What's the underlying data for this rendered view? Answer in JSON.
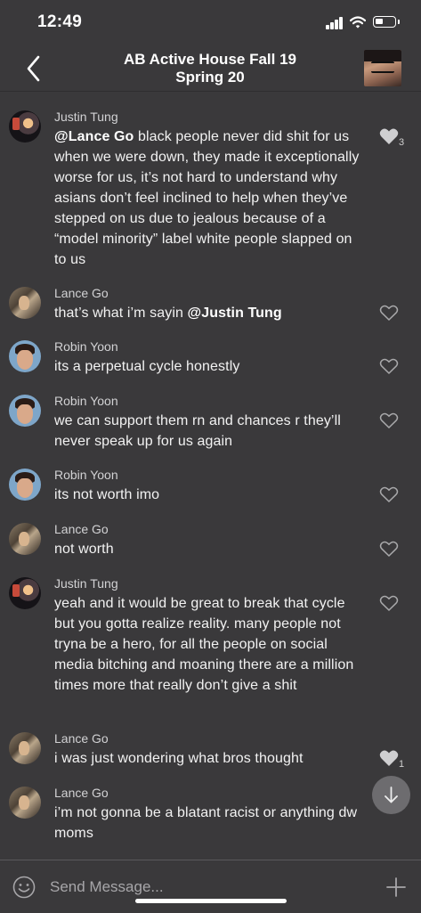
{
  "status_bar": {
    "time": "12:49"
  },
  "header": {
    "title_line1": "AB Active House Fall 19",
    "title_line2": "Spring 20"
  },
  "messages": [
    {
      "author": "Justin Tung",
      "mention": "@Lance Go",
      "text": " black people never did shit for us when we were down, they made it exceptionally worse for us, it’s not hard to understand why asians don’t feel inclined to help when they’ve stepped on us due to jealous because of a “model minority” label white people slapped on to us",
      "likes": "3",
      "liked": true
    },
    {
      "author": "Lance Go",
      "text": "that’s what i’m sayin ",
      "mention": "@Justin Tung",
      "liked": false
    },
    {
      "author": "Robin Yoon",
      "text": "its a perpetual cycle honestly",
      "liked": false
    },
    {
      "author": "Robin Yoon",
      "text": "we can support them rn and chances r they’ll never speak up for us again",
      "liked": false
    },
    {
      "author": "Robin Yoon",
      "text": "its not worth imo",
      "liked": false
    },
    {
      "author": "Lance Go",
      "text": "not worth",
      "liked": false
    },
    {
      "author": "Justin Tung",
      "text": "yeah and it would be great to break that cycle but you gotta realize reality. many people not tryna be a hero, for all the people on social media bitching and moaning there are a million times more that really don’t give a shit",
      "liked": false
    },
    {
      "author": "Lance Go",
      "text": "i was just wondering what bros thought",
      "likes": "1",
      "liked": true
    },
    {
      "author": "Lance Go",
      "text": "i’m not gonna be a blatant racist or anything dw moms",
      "liked": false
    }
  ],
  "composer": {
    "placeholder": "Send Message..."
  },
  "icons": {
    "back": "chevron-left-icon",
    "heart": "heart-icon",
    "scroll_down": "arrow-down-icon",
    "emoji": "smiley-icon",
    "add": "plus-icon"
  },
  "colors": {
    "background": "#3a393b",
    "text": "#ffffff",
    "muted": "#a7a6a9"
  }
}
